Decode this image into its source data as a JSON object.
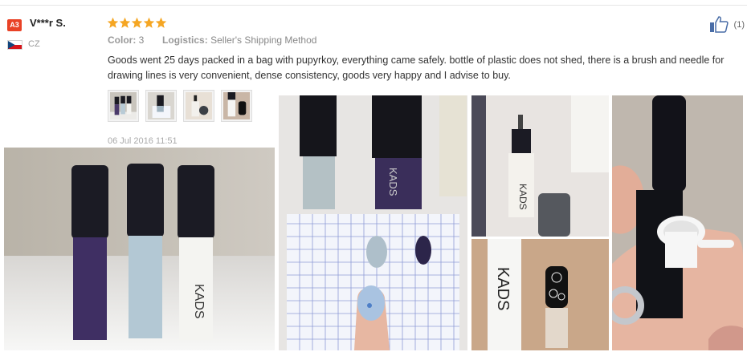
{
  "reviewer": {
    "avatar_label": "A3",
    "name": "V***r S.",
    "country_code": "CZ",
    "avatar_color": "#e94226"
  },
  "rating": {
    "stars": 5,
    "max": 5,
    "color": "#f5a623"
  },
  "meta": {
    "color_label": "Color:",
    "color_value": "3",
    "logistics_label": "Logistics:",
    "logistics_value": "Seller's Shipping Method"
  },
  "review": {
    "text": "Goods went 25 days packed in a bag with pupyrkoy, everything came safely. bottle of plastic does not shed, there is a brush and needle for drawing lines is very convenient, dense consistency, goods very happy and I advise to buy.",
    "date": "06 Jul 2016 11:51"
  },
  "helpful": {
    "icon": "thumbs-up-icon",
    "count": "(1)"
  },
  "thumbnails": [
    {
      "icon": "photo-thumbnail",
      "subject": "three-bottles"
    },
    {
      "icon": "photo-thumbnail",
      "subject": "bottle-on-swatch"
    },
    {
      "icon": "photo-thumbnail",
      "subject": "needle-tip"
    },
    {
      "icon": "photo-thumbnail",
      "subject": "nail-design"
    }
  ],
  "photos": [
    {
      "subject": "three-bottles",
      "brand_text": "KADS"
    },
    {
      "subject": "swatch-grid-with-nail"
    },
    {
      "subject": "needle-tip-bottle",
      "brand_text": "KADS"
    },
    {
      "subject": "bottle-and-nail-art",
      "brand_text": "KADS"
    },
    {
      "subject": "open-bottle-in-hand"
    }
  ]
}
